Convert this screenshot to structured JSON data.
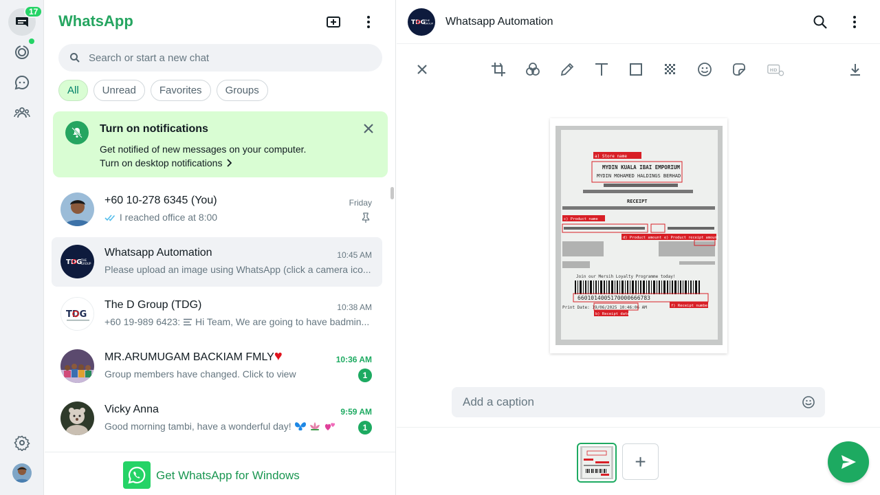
{
  "app": {
    "brand": "WhatsApp"
  },
  "rail": {
    "chats_badge": "17"
  },
  "search": {
    "placeholder": "Search or start a new chat"
  },
  "filters": [
    "All",
    "Unread",
    "Favorites",
    "Groups"
  ],
  "notification": {
    "title": "Turn on notifications",
    "description": "Get notified of new messages on your computer.",
    "link": "Turn on desktop notifications"
  },
  "chats": [
    {
      "name": "+60 10-278 6345 (You)",
      "time": "Friday",
      "message": "I reached office at 8:00",
      "unread": null
    },
    {
      "name": "Whatsapp Automation",
      "time": "10:45 AM",
      "message": "Please upload an image using WhatsApp (click a camera ico...",
      "unread": null
    },
    {
      "name": "The D Group (TDG)",
      "time": "10:38 AM",
      "message_sender": "+60 19-989 6423: ",
      "message": "Hi Team, We are going to have badmin...",
      "unread": null
    },
    {
      "name": "MR.ARUMUGAM BACKIAM FMLY",
      "time": "10:36 AM",
      "message": "Group members have changed. Click to view",
      "unread": "1"
    },
    {
      "name": "Vicky Anna",
      "time": "9:59 AM",
      "message": "Good morning tambi, have a wonderful day!",
      "unread": "1"
    }
  ],
  "get_app": {
    "label": "Get WhatsApp for Windows"
  },
  "conversation": {
    "title": "Whatsapp Automation",
    "avatar_text": "TDG"
  },
  "editor": {
    "caption_placeholder": "Add a caption",
    "add_label": "+"
  },
  "receipt_labels": {
    "store_name": "a) Store name",
    "store_line1": "MYDIN KUALA IBAI EMPORIUM",
    "store_line2": "MYDIN MOHAMED HALDINGS BERHAD",
    "receipt": "RECEIPT",
    "product_name": "c) Product name",
    "product_amount": "d) Product amount",
    "receipt_amount": "e) Product receipt amount",
    "receipt_number": "f) Receipt number",
    "receipt_date": "b) Receipt date",
    "barcode_number": "6601014005170000666783",
    "loyalty": "Join our Mersih Loyalty Programme today!",
    "print_date": "Print Date: 19/06/2025 10:46:06 AM"
  },
  "colors": {
    "brand_green": "#25a560",
    "unread_green": "#1daa61",
    "notif_bg": "#d9fdd3",
    "rail_bg": "#f0f2f5"
  }
}
